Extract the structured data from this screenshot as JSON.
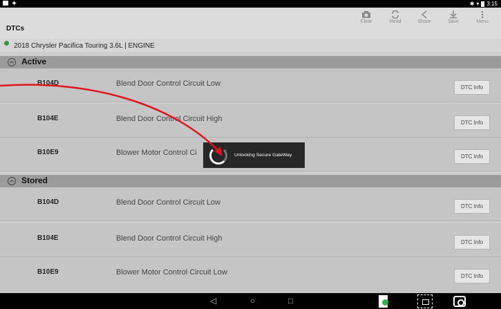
{
  "status_bar": {
    "time": "3:15"
  },
  "toolbar": {
    "title": "DTCs",
    "buttons": [
      {
        "label": "Clear",
        "icon": "clear-icon"
      },
      {
        "label": "Read",
        "icon": "refresh-icon"
      },
      {
        "label": "Share",
        "icon": "share-icon"
      },
      {
        "label": "Save",
        "icon": "download-icon"
      },
      {
        "label": "Menu",
        "icon": "more-vert-icon"
      }
    ]
  },
  "vehicle": {
    "text": "2018 Chrysler Pacifica Touring 3.6L | ENGINE",
    "status_color": "#2c9a47"
  },
  "sections": {
    "active": {
      "label": "Active",
      "rows": [
        {
          "code": "B104D",
          "description": "Blend Door Control Circuit Low",
          "button": "DTC Info"
        },
        {
          "code": "B104E",
          "description": "Blend Door Control Circuit High",
          "button": "DTC Info"
        },
        {
          "code": "B10E9",
          "description": "Blower Motor Control Ci",
          "button": "DTC Info"
        }
      ]
    },
    "stored": {
      "label": "Stored",
      "rows": [
        {
          "code": "B104D",
          "description": "Blend Door Control Circuit Low",
          "button": "DTC Info"
        },
        {
          "code": "B104E",
          "description": "Blend Door Control Circuit High",
          "button": "DTC Info"
        },
        {
          "code": "B10E9",
          "description": "Blower Motor Control Circuit Low",
          "button": "DTC Info"
        }
      ]
    }
  },
  "dialog": {
    "message": "Unlocking Secure GateWay"
  },
  "annotation": {
    "color": "#e0141c"
  }
}
